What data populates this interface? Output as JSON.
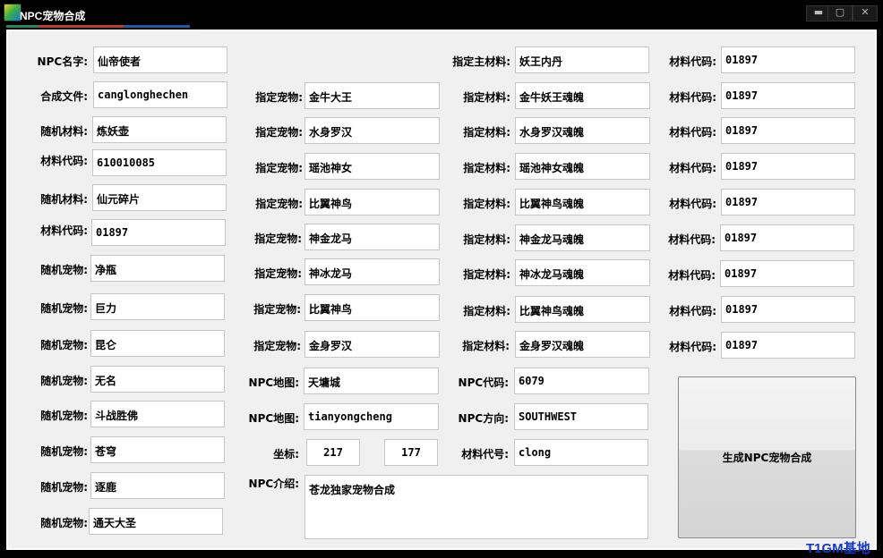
{
  "window": {
    "title": "NPC宠物合成",
    "controls": [
      "▬",
      "▢",
      "✕"
    ],
    "accent_colors": [
      "#1e8a5a",
      "#c0392b",
      "#2459a8"
    ]
  },
  "left": [
    {
      "label": "NPC名字:",
      "value": "仙帝使者"
    },
    {
      "label": "合成文件:",
      "value": "canglonghechen"
    },
    {
      "label": "随机材料:",
      "value": "炼妖壶"
    },
    {
      "label": "材料代码:",
      "value": "610010085"
    },
    {
      "label": "随机材料:",
      "value": "仙元碎片"
    },
    {
      "label": "材料代码:",
      "value": "01897"
    },
    {
      "label": "随机宠物:",
      "value": "净瓶"
    },
    {
      "label": "随机宠物:",
      "value": "巨力"
    },
    {
      "label": "随机宠物:",
      "value": "昆仑"
    },
    {
      "label": "随机宠物:",
      "value": "无名"
    },
    {
      "label": "随机宠物:",
      "value": "斗战胜佛"
    },
    {
      "label": "随机宠物:",
      "value": "苍穹"
    },
    {
      "label": "随机宠物:",
      "value": "逐鹿"
    },
    {
      "label": "随机宠物:",
      "value": "通天大圣"
    }
  ],
  "pets": [
    {
      "label": "指定宠物:",
      "value": "金牛大王"
    },
    {
      "label": "指定宠物:",
      "value": "水身罗汉"
    },
    {
      "label": "指定宠物:",
      "value": "瑶池神女"
    },
    {
      "label": "指定宠物:",
      "value": "比翼神鸟"
    },
    {
      "label": "指定宠物:",
      "value": "神金龙马"
    },
    {
      "label": "指定宠物:",
      "value": "神冰龙马"
    },
    {
      "label": "指定宠物:",
      "value": "比翼神鸟"
    },
    {
      "label": "指定宠物:",
      "value": "金身罗汉"
    }
  ],
  "materials": [
    {
      "label": "指定主材料:",
      "value": "妖王内丹"
    },
    {
      "label": "指定材料:",
      "value": "金牛妖王魂魄"
    },
    {
      "label": "指定材料:",
      "value": "水身罗汉魂魄"
    },
    {
      "label": "指定材料:",
      "value": "瑶池神女魂魄"
    },
    {
      "label": "指定材料:",
      "value": "比翼神鸟魂魄"
    },
    {
      "label": "指定材料:",
      "value": "神金龙马魂魄"
    },
    {
      "label": "指定材料:",
      "value": "神冰龙马魂魄"
    },
    {
      "label": "指定材料:",
      "value": "比翼神鸟魂魄"
    },
    {
      "label": "指定材料:",
      "value": "金身罗汉魂魄"
    }
  ],
  "codes": [
    {
      "label": "材料代码:",
      "value": "01897"
    },
    {
      "label": "材料代码:",
      "value": "01897"
    },
    {
      "label": "材料代码:",
      "value": "01897"
    },
    {
      "label": "材料代码:",
      "value": "01897"
    },
    {
      "label": "材料代码:",
      "value": "01897"
    },
    {
      "label": "材料代码:",
      "value": "01897"
    },
    {
      "label": "材料代码:",
      "value": "01897"
    },
    {
      "label": "材料代码:",
      "value": "01897"
    },
    {
      "label": "材料代码:",
      "value": "01897"
    }
  ],
  "npc": {
    "map_label": "NPC地图:",
    "map_value": "天墉城",
    "map2_label": "NPC地图:",
    "map2_value": "tianyongcheng",
    "coord_label": "坐标:",
    "coord_x": "217",
    "coord_y": "177",
    "code_label": "NPC代码:",
    "code_value": "6079",
    "dir_label": "NPC方向:",
    "dir_value": "SOUTHWEST",
    "matno_label": "材料代号:",
    "matno_value": "clong",
    "intro_label": "NPC介绍:",
    "intro_value": "苍龙独家宠物合成"
  },
  "generate_button": "生成NPC宠物合成",
  "watermark": "T1GM基地"
}
